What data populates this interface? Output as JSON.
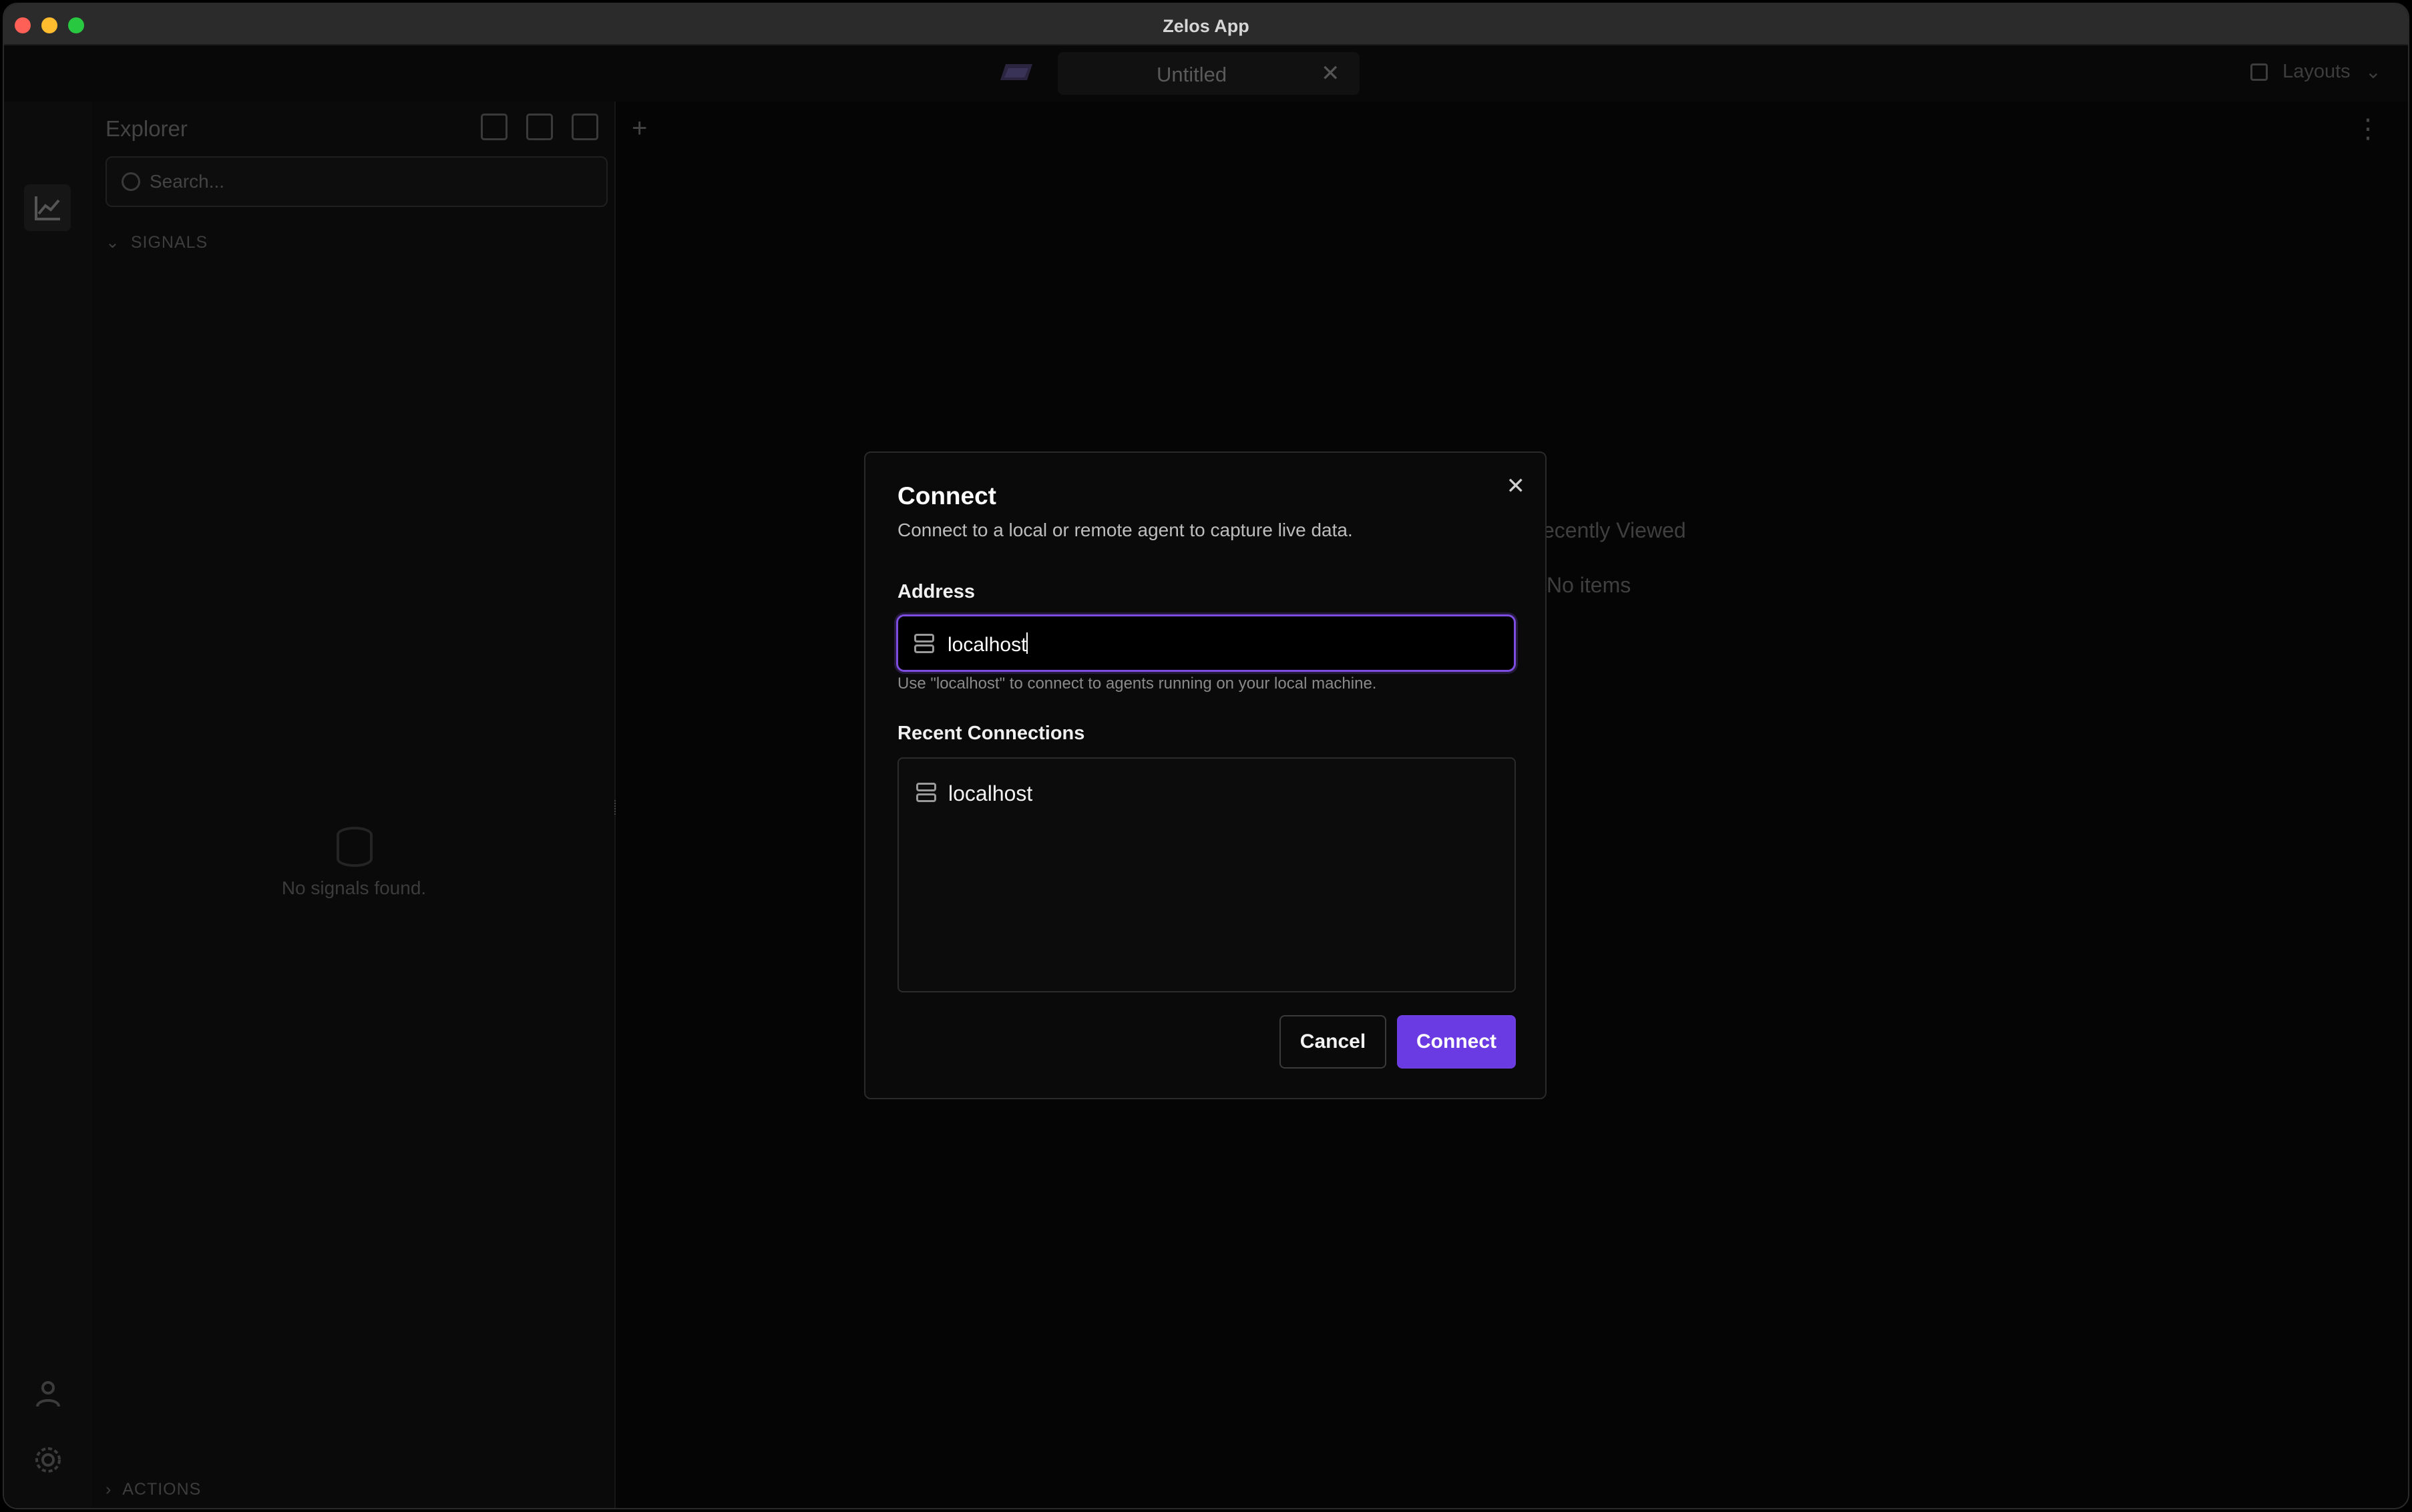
{
  "window": {
    "title": "Zelos App"
  },
  "tabbar": {
    "tab_label": "Untitled",
    "tab_close_glyph": "✕",
    "layouts_label": "Layouts",
    "chevron_glyph": "⌄"
  },
  "explorer": {
    "title": "Explorer",
    "search_placeholder": "Search...",
    "signals_section": "SIGNALS",
    "actions_section": "ACTIONS",
    "empty_text": "No signals found."
  },
  "main": {
    "add_tab_glyph": "+",
    "menu_glyph": "⋮",
    "recently_viewed": "ecently Viewed",
    "no_items": "No items"
  },
  "modal": {
    "title": "Connect",
    "subtitle": "Connect to a local or remote agent to capture live data.",
    "address_label": "Address",
    "address_value": "localhost",
    "hint": "Use \"localhost\" to connect to agents running on your local machine.",
    "recent_label": "Recent Connections",
    "recent_items": [
      {
        "label": "localhost"
      }
    ],
    "cancel_label": "Cancel",
    "connect_label": "Connect",
    "close_glyph": "✕"
  },
  "colors": {
    "accent": "#6a3be2",
    "focus_ring": "#7c4dde",
    "background": "#050505",
    "traffic_red": "#fe5f57",
    "traffic_yellow": "#febc2e",
    "traffic_green": "#28c840"
  },
  "icons": [
    "server-icon",
    "close-icon",
    "search-icon",
    "chart-icon",
    "user-icon",
    "gear-icon",
    "database-icon",
    "grid-layout-icon"
  ]
}
